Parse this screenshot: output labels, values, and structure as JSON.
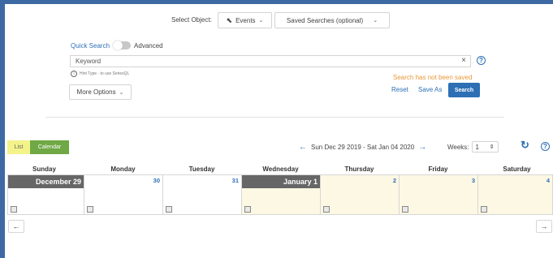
{
  "header": {
    "select_object_label": "Select Object:",
    "object_value": "Events",
    "saved_searches": "Saved Searches (optional)"
  },
  "search_mode": {
    "quick": "Quick Search",
    "advanced": "Advanced"
  },
  "keyword_input": {
    "value": "Keyword",
    "clear": "×"
  },
  "hint": "Hint Type - to use SeriesQL",
  "not_saved_message": "Search has not been saved",
  "more_options": "More Options",
  "actions": {
    "reset": "Reset",
    "save_as": "Save As",
    "search": "Search"
  },
  "view": {
    "list": "List",
    "calendar": "Calendar"
  },
  "date_range": "Sun Dec 29 2019 - Sat Jan 04 2020",
  "weeks": {
    "label": "Weeks:",
    "value": "1"
  },
  "days": [
    {
      "name": "Sunday",
      "date": "December 29",
      "highlight": true,
      "fill": false
    },
    {
      "name": "Monday",
      "date": "30",
      "highlight": false,
      "fill": false
    },
    {
      "name": "Tuesday",
      "date": "31",
      "highlight": false,
      "fill": false
    },
    {
      "name": "Wednesday",
      "date": "January 1",
      "highlight": true,
      "fill": true
    },
    {
      "name": "Thursday",
      "date": "2",
      "highlight": false,
      "fill": true
    },
    {
      "name": "Friday",
      "date": "3",
      "highlight": false,
      "fill": true
    },
    {
      "name": "Saturday",
      "date": "4",
      "highlight": false,
      "fill": true
    }
  ],
  "colors": {
    "accent": "#2c6fb5",
    "warning": "#e8983a",
    "list_tab": "#f3f38a",
    "calendar_tab": "#6fa845"
  }
}
